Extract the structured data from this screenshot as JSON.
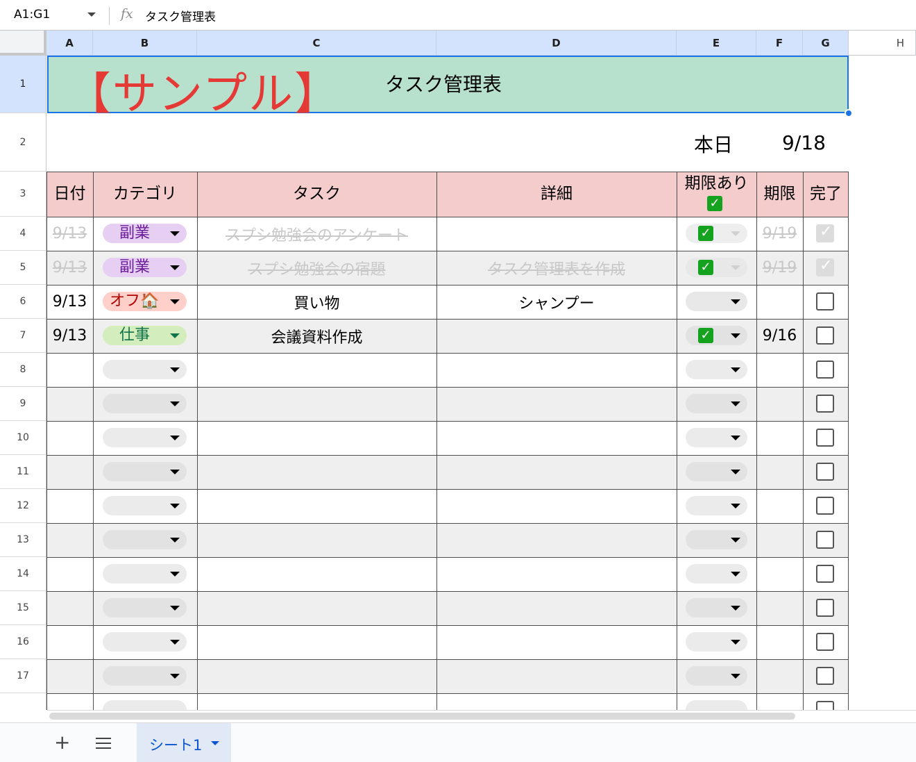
{
  "formula_bar": {
    "cell_ref": "A1:G1",
    "fx": "fx",
    "content": "タスク管理表"
  },
  "columns": [
    "A",
    "B",
    "C",
    "D",
    "E",
    "F",
    "G",
    "H"
  ],
  "row_numbers": [
    "1",
    "2",
    "3",
    "4",
    "5",
    "6",
    "7",
    "8",
    "9",
    "10",
    "11",
    "12",
    "13",
    "14",
    "15",
    "16",
    "17"
  ],
  "banner": {
    "sample": "【サンプル】",
    "title": "タスク管理表",
    "background": "#b7e1cd",
    "sample_color": "#e53935"
  },
  "today": {
    "label": "本日",
    "date": "9/18"
  },
  "table_headers": {
    "date": "日付",
    "category": "カテゴリ",
    "task": "タスク",
    "detail": "詳細",
    "has_deadline": "期限あり",
    "has_deadline_icon": "✓",
    "deadline": "期限",
    "done": "完了",
    "background": "#f4cccc"
  },
  "rows": [
    {
      "date": "9/13",
      "category": "副業",
      "category_color": "#e6cff2",
      "category_text": "#6a1b9a",
      "task": "スプシ勉強会のアンケート",
      "detail": "",
      "has_deadline": true,
      "deadline": "9/19",
      "done": true
    },
    {
      "date": "9/13",
      "category": "副業",
      "category_color": "#e6cff2",
      "category_text": "#6a1b9a",
      "task": "スプシ勉強会の宿題",
      "detail": "タスク管理表を作成",
      "has_deadline": true,
      "deadline": "9/19",
      "done": true
    },
    {
      "date": "9/13",
      "category": "オフ🏠",
      "category_color": "#ffcfc9",
      "category_text": "#b10202",
      "task": "買い物",
      "detail": "シャンプー",
      "has_deadline": false,
      "deadline": "",
      "done": false
    },
    {
      "date": "9/13",
      "category": "仕事",
      "category_color": "#d4edbc",
      "category_text": "#11734b",
      "task": "会議資料作成",
      "detail": "",
      "has_deadline": true,
      "deadline": "9/16",
      "done": false
    }
  ],
  "sheet_tabs": {
    "add_icon": "+",
    "menu_icon": "hamburger-icon",
    "active_tab": "シート1"
  }
}
